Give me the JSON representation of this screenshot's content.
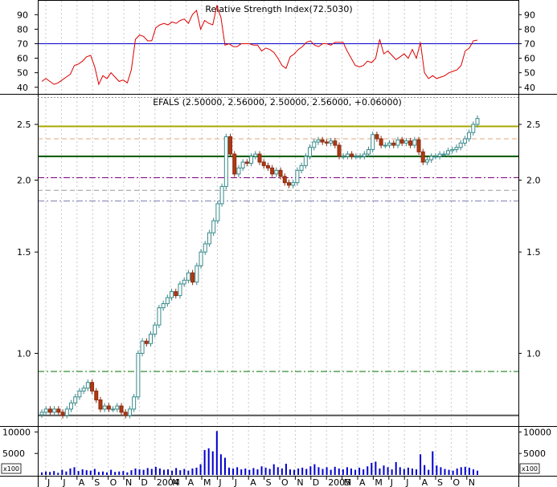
{
  "chart_data": {
    "type": "candlestick",
    "rsi": {
      "title": "Relative Strength Index(72.5030)",
      "yticks": [
        40,
        50,
        60,
        70,
        80,
        90
      ],
      "ylim": [
        36,
        99
      ],
      "reference_line": 70,
      "values": [
        44,
        46,
        44,
        42,
        43,
        45,
        47,
        49,
        55,
        56,
        58,
        61,
        62,
        54,
        42,
        48,
        46,
        50,
        47,
        44,
        45,
        43,
        52,
        73,
        76,
        75,
        72,
        72,
        81,
        83,
        84,
        83,
        85,
        84,
        86,
        87,
        84,
        90,
        93,
        80,
        86,
        84,
        83,
        96,
        88,
        69,
        70,
        68,
        68,
        70,
        70,
        70,
        69,
        69,
        65,
        67,
        66,
        64,
        60,
        55,
        53,
        61,
        63,
        66,
        68,
        71,
        72,
        69,
        68,
        70,
        70,
        69,
        71,
        71,
        71,
        65,
        60,
        55,
        54,
        55,
        58,
        57,
        60,
        73,
        63,
        65,
        62,
        59,
        61,
        63,
        60,
        66,
        60,
        71,
        50,
        46,
        48,
        46,
        47,
        48,
        50,
        51,
        52,
        55,
        65,
        67,
        72,
        72.5
      ]
    },
    "price": {
      "title": "EFALS (2.50000, 2.56000, 2.50000, 2.56000, +0.06000)",
      "scale": "log",
      "yticks": [
        "1.0",
        "1.5",
        "2.0",
        "2.5"
      ],
      "ylim": [
        0.75,
        2.78
      ],
      "close": [
        0.79,
        0.8,
        0.79,
        0.8,
        0.79,
        0.78,
        0.8,
        0.82,
        0.84,
        0.86,
        0.87,
        0.89,
        0.86,
        0.83,
        0.8,
        0.81,
        0.8,
        0.8,
        0.81,
        0.79,
        0.78,
        0.8,
        0.84,
        1.0,
        1.05,
        1.04,
        1.08,
        1.12,
        1.2,
        1.22,
        1.25,
        1.28,
        1.26,
        1.32,
        1.34,
        1.38,
        1.33,
        1.42,
        1.5,
        1.55,
        1.62,
        1.7,
        1.82,
        1.95,
        2.38,
        2.22,
        2.05,
        2.1,
        2.15,
        2.14,
        2.2,
        2.22,
        2.15,
        2.12,
        2.1,
        2.05,
        2.08,
        2.03,
        1.98,
        1.96,
        1.98,
        2.08,
        2.12,
        2.2,
        2.28,
        2.33,
        2.35,
        2.33,
        2.32,
        2.34,
        2.3,
        2.2,
        2.2,
        2.22,
        2.2,
        2.2,
        2.2,
        2.22,
        2.26,
        2.4,
        2.36,
        2.3,
        2.3,
        2.32,
        2.3,
        2.35,
        2.32,
        2.34,
        2.3,
        2.35,
        2.24,
        2.15,
        2.17,
        2.2,
        2.2,
        2.22,
        2.22,
        2.25,
        2.26,
        2.28,
        2.32,
        2.36,
        2.42,
        2.5,
        2.56
      ],
      "lines": [
        {
          "value": 2.48,
          "color": "#a8a800",
          "style": "solid"
        },
        {
          "value": 2.36,
          "color": "#e2a87c",
          "style": "dashed"
        },
        {
          "value": 2.2,
          "color": "#005500",
          "style": "solid"
        },
        {
          "value": 2.02,
          "color": "#800080",
          "style": "dashdot"
        },
        {
          "value": 1.92,
          "color": "#999999",
          "style": "dashed"
        },
        {
          "value": 1.84,
          "color": "#8080b0",
          "style": "dashdot"
        },
        {
          "value": 0.93,
          "color": "#007000",
          "style": "dashdot"
        },
        {
          "value": 0.78,
          "color": "#555555",
          "style": "solid"
        }
      ]
    },
    "volume": {
      "yticks": [
        "10000",
        "5000"
      ],
      "unit_label": "x100",
      "ylim": [
        0,
        11000
      ],
      "values": [
        600,
        800,
        700,
        900,
        500,
        1200,
        800,
        1500,
        1800,
        900,
        1300,
        1100,
        1000,
        1400,
        700,
        800,
        600,
        1200,
        700,
        800,
        900,
        600,
        1100,
        1500,
        1300,
        1200,
        1600,
        1400,
        1900,
        1500,
        1200,
        1300,
        1000,
        1600,
        1100,
        1400,
        1000,
        1500,
        1700,
        2500,
        5800,
        6200,
        5500,
        10200,
        4800,
        4000,
        1700,
        1500,
        1800,
        1300,
        1500,
        1200,
        1600,
        1300,
        2000,
        1700,
        1400,
        2500,
        1800,
        1500,
        2600,
        1300,
        1200,
        1500,
        1700,
        1400,
        2000,
        2500,
        1800,
        1400,
        1800,
        1200,
        1900,
        1500,
        1300,
        1800,
        1500,
        1200,
        1700,
        1300,
        2000,
        2800,
        3100,
        1500,
        2200,
        1800,
        1300,
        3000,
        1800,
        1400,
        1700,
        1500,
        1300,
        4800,
        2300,
        1200,
        5500,
        2200,
        1800,
        1400,
        1200,
        1000,
        1500,
        1800,
        1900,
        1700,
        1300,
        1000
      ]
    },
    "x_axis": {
      "labels": [
        "J",
        "J",
        "A",
        "S",
        "O",
        "N",
        "D",
        "2004",
        "M",
        "A",
        "M",
        "J",
        "J",
        "A",
        "S",
        "O",
        "N",
        "D",
        "2005",
        "M",
        "A",
        "M",
        "J",
        "J",
        "A",
        "S",
        "O",
        "N"
      ]
    }
  }
}
